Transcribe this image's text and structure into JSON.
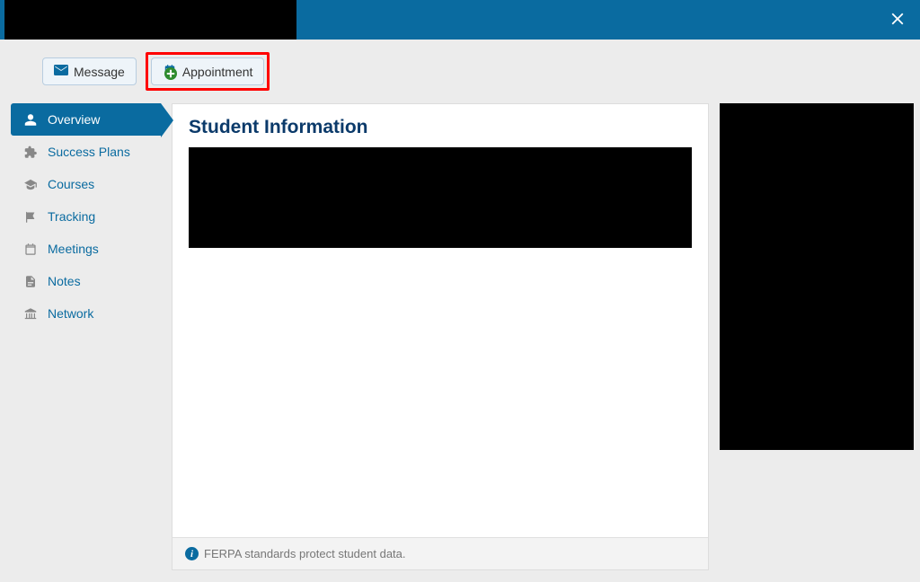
{
  "toolbar": {
    "message_label": "Message",
    "appointment_label": "Appointment"
  },
  "sidebar": {
    "items": [
      {
        "label": "Overview",
        "icon": "user-icon",
        "active": true
      },
      {
        "label": "Success Plans",
        "icon": "puzzle-icon",
        "active": false
      },
      {
        "label": "Courses",
        "icon": "graduation-icon",
        "active": false
      },
      {
        "label": "Tracking",
        "icon": "flag-icon",
        "active": false
      },
      {
        "label": "Meetings",
        "icon": "calendar-icon",
        "active": false
      },
      {
        "label": "Notes",
        "icon": "document-icon",
        "active": false
      },
      {
        "label": "Network",
        "icon": "institution-icon",
        "active": false
      }
    ]
  },
  "panel": {
    "title": "Student Information",
    "footer_text": "FERPA standards protect student data."
  }
}
